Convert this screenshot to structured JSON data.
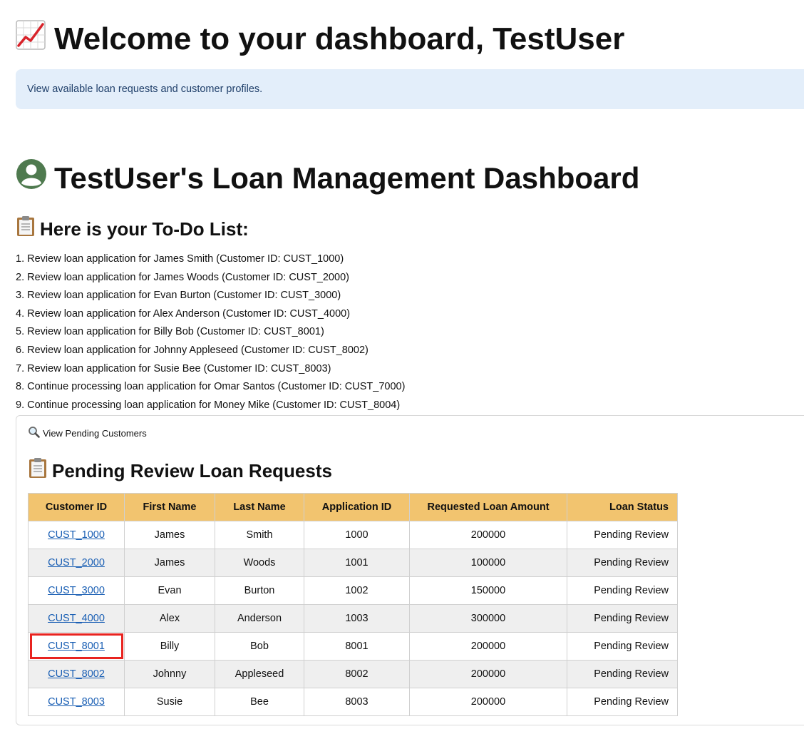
{
  "header": {
    "welcome_title": "Welcome to your dashboard, TestUser",
    "welcome_icon": "chart-increasing-icon"
  },
  "info": {
    "text": "View available loan requests and customer profiles.",
    "background_color": "#e3eefa"
  },
  "dashboard": {
    "title": "TestUser's Loan Management Dashboard",
    "icon": "user-avatar-icon"
  },
  "todo": {
    "title": "Here is your To-Do List:",
    "icon": "clipboard-icon",
    "items": [
      "1. Review loan application for James Smith (Customer ID: CUST_1000)",
      "2. Review loan application for James Woods (Customer ID: CUST_2000)",
      "3. Review loan application for Evan Burton (Customer ID: CUST_3000)",
      "4. Review loan application for Alex Anderson (Customer ID: CUST_4000)",
      "5. Review loan application for Billy Bob (Customer ID: CUST_8001)",
      "6. Review loan application for Johnny Appleseed (Customer ID: CUST_8002)",
      "7. Review loan application for Susie Bee (Customer ID: CUST_8003)",
      "8. Continue processing loan application for Omar Santos (Customer ID: CUST_7000)",
      "9. Continue processing loan application for Money Mike (Customer ID: CUST_8004)"
    ]
  },
  "pending": {
    "expander_label": "View Pending Customers",
    "expander_icon": "magnifying-glass-icon",
    "title": "Pending Review Loan Requests",
    "title_icon": "clipboard-icon",
    "header_color": "#f2c46f",
    "columns": [
      "Customer ID",
      "First Name",
      "Last Name",
      "Application ID",
      "Requested Loan Amount",
      "Loan Status"
    ],
    "rows": [
      {
        "customer_id": "CUST_1000",
        "first_name": "James",
        "last_name": "Smith",
        "application_id": "1000",
        "amount": "200000",
        "status": "Pending Review"
      },
      {
        "customer_id": "CUST_2000",
        "first_name": "James",
        "last_name": "Woods",
        "application_id": "1001",
        "amount": "100000",
        "status": "Pending Review"
      },
      {
        "customer_id": "CUST_3000",
        "first_name": "Evan",
        "last_name": "Burton",
        "application_id": "1002",
        "amount": "150000",
        "status": "Pending Review"
      },
      {
        "customer_id": "CUST_4000",
        "first_name": "Alex",
        "last_name": "Anderson",
        "application_id": "1003",
        "amount": "300000",
        "status": "Pending Review"
      },
      {
        "customer_id": "CUST_8001",
        "first_name": "Billy",
        "last_name": "Bob",
        "application_id": "8001",
        "amount": "200000",
        "status": "Pending Review"
      },
      {
        "customer_id": "CUST_8002",
        "first_name": "Johnny",
        "last_name": "Appleseed",
        "application_id": "8002",
        "amount": "200000",
        "status": "Pending Review"
      },
      {
        "customer_id": "CUST_8003",
        "first_name": "Susie",
        "last_name": "Bee",
        "application_id": "8003",
        "amount": "200000",
        "status": "Pending Review"
      }
    ],
    "highlight_color": "#e8231f"
  }
}
